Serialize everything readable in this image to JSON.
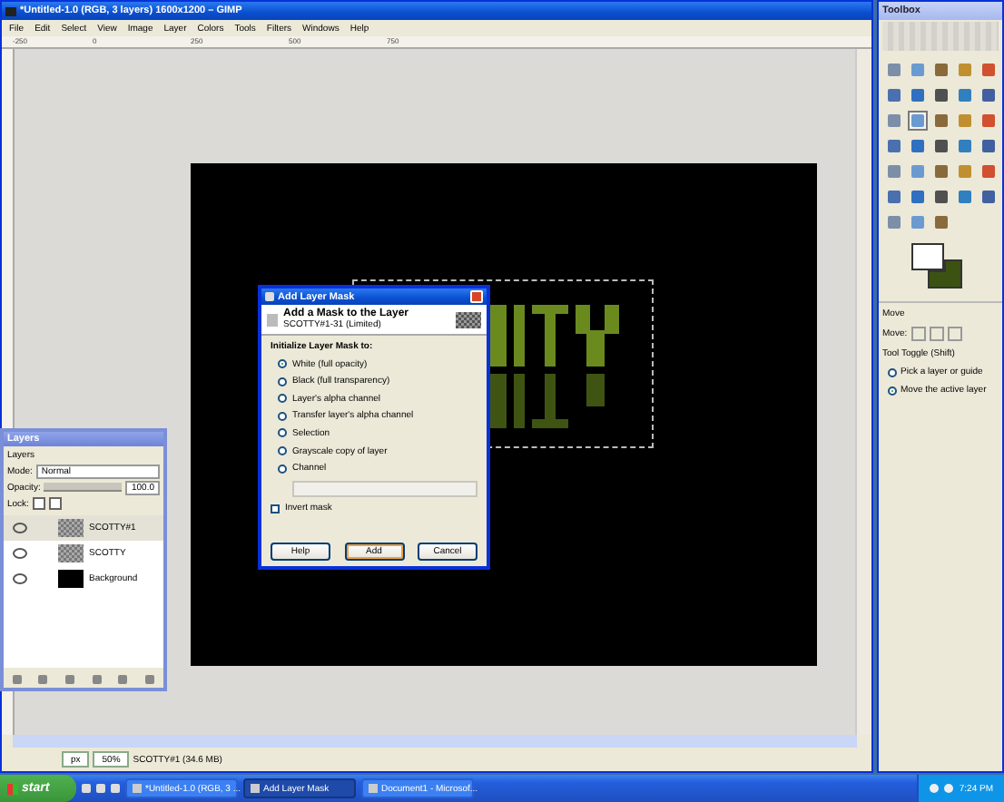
{
  "image_window": {
    "title": "*Untitled-1.0 (RGB, 3 layers) 1600x1200 – GIMP",
    "menu": [
      "File",
      "Edit",
      "Select",
      "View",
      "Image",
      "Layer",
      "Colors",
      "Tools",
      "Filters",
      "Windows",
      "Help"
    ],
    "ruler_labels": [
      "-250",
      "0",
      "250",
      "500",
      "750"
    ],
    "status": {
      "unit": "px",
      "zoom": "50%",
      "message": "SCOTTY#1 (34.6 MB)"
    }
  },
  "layers_dock": {
    "title": "Layers",
    "tab": "Layers",
    "mode_label": "Mode:",
    "mode": "Normal",
    "opacity_label": "Opacity:",
    "opacity": "100.0",
    "level": 1,
    "lock_label": "Lock:",
    "locks": [
      {
        "checked": false
      },
      {
        "checked": false
      }
    ],
    "layers": [
      {
        "name": "SCOTTY#1",
        "selected": true,
        "visible": true,
        "kind": "checker"
      },
      {
        "name": "SCOTTY",
        "selected": false,
        "visible": true,
        "kind": "checker"
      },
      {
        "name": "Background",
        "selected": false,
        "visible": true,
        "kind": "black"
      }
    ]
  },
  "dialog": {
    "title": "Add Layer Mask",
    "heading": "Add a Mask to the Layer",
    "subheading": "SCOTTY#1-31 (Limited)",
    "section": "Initialize Layer Mask to:",
    "options": [
      {
        "label": "White (full opacity)",
        "selected": true
      },
      {
        "label": "Black (full transparency)",
        "selected": false
      },
      {
        "label": "Layer's alpha channel",
        "selected": false
      },
      {
        "label": "Transfer layer's alpha channel",
        "selected": false
      },
      {
        "label": "Selection",
        "selected": false
      },
      {
        "label": "Grayscale copy of layer",
        "selected": false
      },
      {
        "label": "Channel",
        "selected": false
      }
    ],
    "channel_select": {
      "disabled": true
    },
    "invert": {
      "label": "Invert mask",
      "checked": false
    },
    "buttons": [
      {
        "label": "Help",
        "default": false
      },
      {
        "label": "Add",
        "default": true
      },
      {
        "label": "Cancel",
        "default": false
      }
    ]
  },
  "toolbox": {
    "title": "Toolbox",
    "tools": [
      {
        "selected": false
      },
      {
        "selected": false
      },
      {
        "selected": false
      },
      {
        "selected": false
      },
      {
        "selected": false
      },
      {
        "selected": false
      },
      {
        "selected": false
      },
      {
        "selected": false
      },
      {
        "selected": false
      },
      {
        "selected": false
      },
      {
        "selected": false
      },
      {
        "selected": true
      },
      {
        "selected": false
      },
      {
        "selected": false
      },
      {
        "selected": false
      },
      {
        "selected": false
      },
      {
        "selected": false
      },
      {
        "selected": false
      },
      {
        "selected": false
      },
      {
        "selected": false
      },
      {
        "selected": false
      },
      {
        "selected": false
      },
      {
        "selected": false
      },
      {
        "selected": false
      },
      {
        "selected": false
      },
      {
        "selected": false
      },
      {
        "selected": false
      },
      {
        "selected": false
      },
      {
        "selected": false
      },
      {
        "selected": false
      },
      {
        "selected": false
      },
      {
        "selected": false
      },
      {
        "selected": false
      }
    ],
    "swatches": [
      {
        "kind": "foreground",
        "color": "#ffffff"
      },
      {
        "kind": "background",
        "color": "#3c5212"
      }
    ],
    "options": {
      "title": "Move",
      "move_label": "Move:",
      "toggle_label": "Tool Toggle (Shift)",
      "choices": [
        {
          "label": "Pick a layer or guide",
          "selected": false
        },
        {
          "label": "Move the active layer",
          "selected": true
        }
      ]
    }
  },
  "taskbar": {
    "start": "start",
    "tasks": [
      {
        "label": "*Untitled-1.0 (RGB, 3 ...",
        "selected": false
      },
      {
        "label": "Add Layer Mask",
        "selected": true
      },
      {
        "label": "Document1 - Microsof...",
        "selected": false
      }
    ],
    "clock": "7:24 PM"
  }
}
